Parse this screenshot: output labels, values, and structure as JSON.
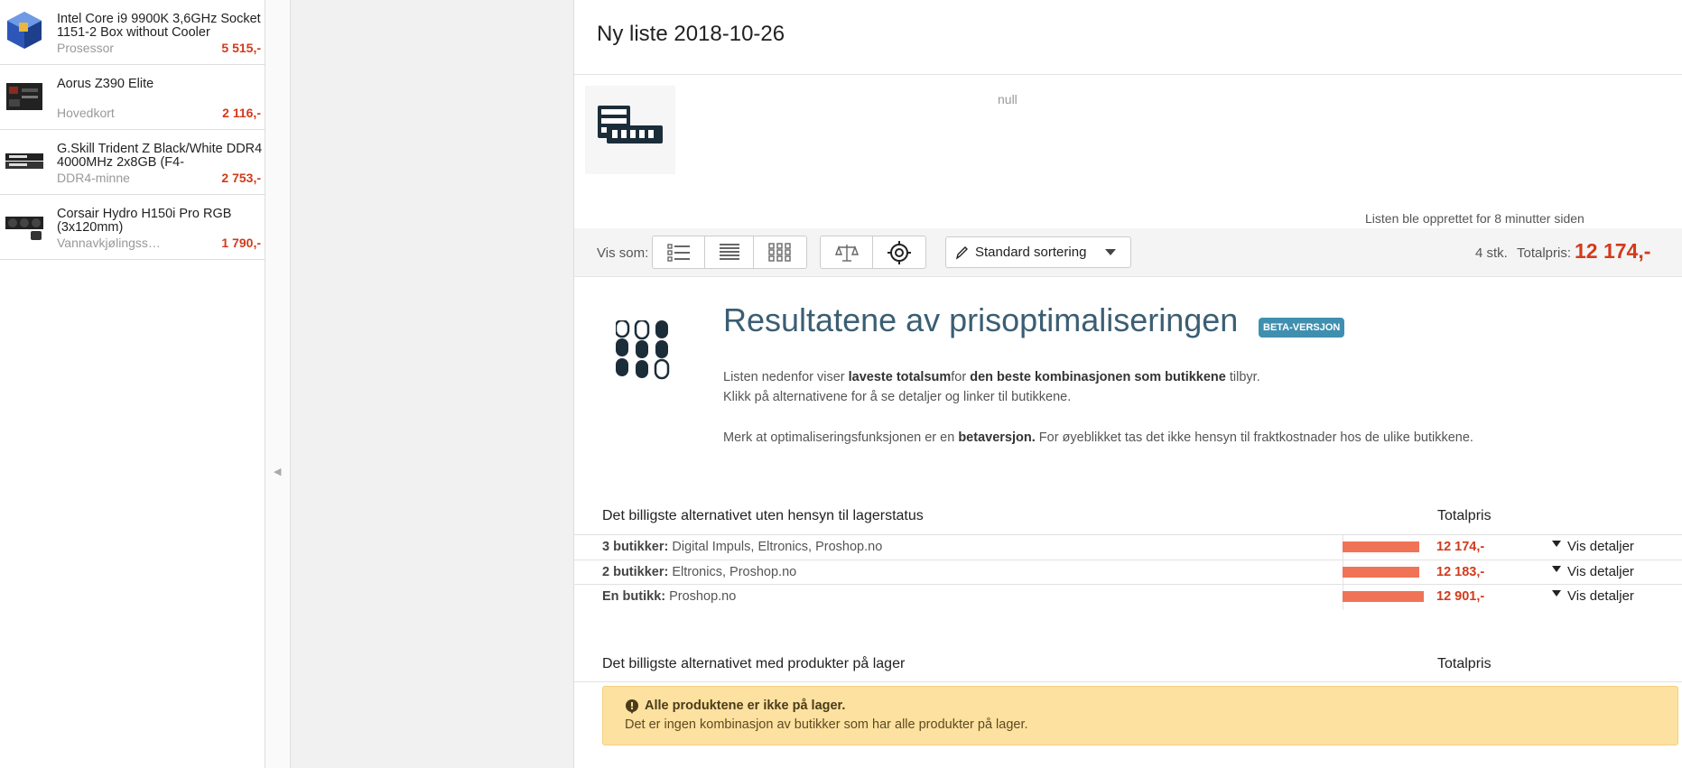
{
  "sidebar": {
    "items": [
      {
        "name": "Intel Core i9 9900K 3,6GHz Socket 1151-2 Box without Cooler",
        "category": "Prosessor",
        "price": "5 515,-"
      },
      {
        "name": "Aorus Z390 Elite",
        "category": "Hovedkort",
        "price": "2 116,-"
      },
      {
        "name": "G.Skill Trident Z Black/White DDR4 4000MHz 2x8GB (F4-",
        "category": "DDR4-minne",
        "price": "2 753,-"
      },
      {
        "name": "Corsair Hydro H150i Pro RGB (3x120mm)",
        "category": "Vannavkjølingss…",
        "price": "1 790,-"
      }
    ]
  },
  "main": {
    "title": "Ny liste 2018-10-26",
    "null_text": "null",
    "created": "Listen ble opprettet for 8 minutter siden"
  },
  "toolbar": {
    "view_label": "Vis som:",
    "sort_label": "Standard sortering",
    "count": "4 stk.",
    "total_label": "Totalpris:",
    "total_value": "12 174,-"
  },
  "optimization": {
    "heading": "Resultatene av prisoptimaliseringen",
    "badge": "BETA-VERSJON",
    "p1_a": "Listen nedenfor viser ",
    "p1_b": "laveste totalsum",
    "p1_c": "for ",
    "p1_d": "den beste kombinasjonen som butikkene",
    "p1_e": " tilbyr.",
    "p2": "Klikk på alternativene for å se detaljer og linker til butikkene.",
    "p3_a": "Merk at optimaliseringsfunksjonen er en ",
    "p3_b": "betaversjon.",
    "p3_c": " For øyeblikket tas det ikke hensyn til fraktkostnader hos de ulike butikkene."
  },
  "section1": {
    "heading": "Det billigste alternativet uten hensyn til lagerstatus",
    "total_header": "Totalpris",
    "rows": [
      {
        "label": "3 butikker:",
        "stores": " Digital Impuls, Eltronics, Proshop.no",
        "price": "12 174,-",
        "details": "Vis detaljer",
        "bar_fraction": 0.943
      },
      {
        "label": "2 butikker:",
        "stores": " Eltronics, Proshop.no",
        "price": "12 183,-",
        "details": "Vis detaljer",
        "bar_fraction": 0.944
      },
      {
        "label": "En butikk:",
        "stores": " Proshop.no",
        "price": "12 901,-",
        "details": "Vis detaljer",
        "bar_fraction": 1.0
      }
    ]
  },
  "section2": {
    "heading": "Det billigste alternativet med produkter på lager",
    "total_header": "Totalpris"
  },
  "warning": {
    "title": "Alle produktene er ikke på lager.",
    "text": "Det er ingen kombinasjon av butikker som har alle produkter på lager."
  },
  "colors": {
    "price_red": "#d33a1b",
    "bar": "#f07358",
    "heading": "#3b5e73",
    "badge": "#3f8fb0",
    "warning_bg": "#fde1a0"
  }
}
